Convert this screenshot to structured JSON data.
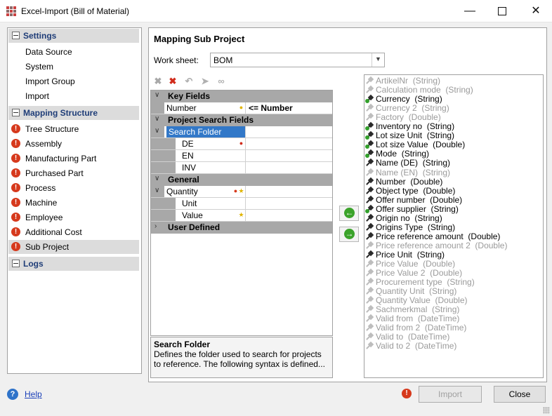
{
  "window": {
    "title": "Excel-Import (Bill of Material)"
  },
  "nav": {
    "settings": {
      "label": "Settings",
      "items": [
        "Data Source",
        "System",
        "Import Group",
        "Import"
      ]
    },
    "mapping": {
      "label": "Mapping Structure",
      "items": [
        "Tree Structure",
        "Assembly",
        "Manufacturing Part",
        "Purchased Part",
        "Process",
        "Machine",
        "Employee",
        "Additional Cost",
        "Sub Project"
      ],
      "selected": "Sub Project"
    },
    "logs": {
      "label": "Logs"
    }
  },
  "main": {
    "title": "Mapping Sub Project",
    "worksheet_label": "Work sheet:",
    "worksheet_value": "BOM"
  },
  "grid": {
    "key_fields": {
      "label": "Key Fields",
      "number_label": "Number",
      "number_value": "<= Number"
    },
    "project_search": {
      "label": "Project Search Fields",
      "search_folder": "Search Folder",
      "de": "DE",
      "en": "EN",
      "inv": "INV"
    },
    "general": {
      "label": "General",
      "quantity": "Quantity",
      "unit": "Unit",
      "value": "Value"
    },
    "user_defined": {
      "label": "User Defined"
    }
  },
  "description": {
    "heading": "Search Folder",
    "text": "Defines the folder used to search for projects to reference. The following syntax is defined..."
  },
  "fields": [
    {
      "name": "ArtikelNr",
      "type": "(String)",
      "active": false,
      "green": false
    },
    {
      "name": "Calculation mode",
      "type": "(String)",
      "active": false,
      "green": false
    },
    {
      "name": "Currency",
      "type": "(String)",
      "active": true,
      "green": true
    },
    {
      "name": "Currency 2",
      "type": "(String)",
      "active": false,
      "green": false
    },
    {
      "name": "Factory",
      "type": "(Double)",
      "active": false,
      "green": false
    },
    {
      "name": "Inventory no",
      "type": "(String)",
      "active": true,
      "green": true
    },
    {
      "name": "Lot size Unit",
      "type": "(String)",
      "active": true,
      "green": true
    },
    {
      "name": "Lot size Value",
      "type": "(Double)",
      "active": true,
      "green": true
    },
    {
      "name": "Mode",
      "type": "(String)",
      "active": true,
      "green": true
    },
    {
      "name": "Name (DE)",
      "type": "(String)",
      "active": true,
      "green": false
    },
    {
      "name": "Name (EN)",
      "type": "(String)",
      "active": false,
      "green": false
    },
    {
      "name": "Number",
      "type": "(Double)",
      "active": true,
      "green": false
    },
    {
      "name": "Object type",
      "type": "(Double)",
      "active": true,
      "green": false
    },
    {
      "name": "Offer number",
      "type": "(Double)",
      "active": true,
      "green": false
    },
    {
      "name": "Offer supplier",
      "type": "(String)",
      "active": true,
      "green": true
    },
    {
      "name": "Origin no",
      "type": "(String)",
      "active": true,
      "green": false
    },
    {
      "name": "Origins Type",
      "type": "(String)",
      "active": true,
      "green": false
    },
    {
      "name": "Price reference amount",
      "type": "(Double)",
      "active": true,
      "green": false
    },
    {
      "name": "Price reference amount 2",
      "type": "(Double)",
      "active": false,
      "green": false
    },
    {
      "name": "Price Unit",
      "type": "(String)",
      "active": true,
      "green": false
    },
    {
      "name": "Price Value",
      "type": "(Double)",
      "active": false,
      "green": false
    },
    {
      "name": "Price Value 2",
      "type": "(Double)",
      "active": false,
      "green": false
    },
    {
      "name": "Procurement type",
      "type": "(String)",
      "active": false,
      "green": false
    },
    {
      "name": "Quantity Unit",
      "type": "(String)",
      "active": false,
      "green": false
    },
    {
      "name": "Quantity Value",
      "type": "(Double)",
      "active": false,
      "green": false
    },
    {
      "name": "Sachmerkmal",
      "type": "(String)",
      "active": false,
      "green": false
    },
    {
      "name": "Valid from",
      "type": "(DateTime)",
      "active": false,
      "green": false
    },
    {
      "name": "Valid from 2",
      "type": "(DateTime)",
      "active": false,
      "green": false
    },
    {
      "name": "Valid to",
      "type": "(DateTime)",
      "active": false,
      "green": false
    },
    {
      "name": "Valid to 2",
      "type": "(DateTime)",
      "active": false,
      "green": false
    }
  ],
  "footer": {
    "help": "Help",
    "import": "Import",
    "close": "Close"
  },
  "colors": {
    "error": "#d6391c",
    "selection": "#3278c8",
    "nav_header_text": "#1f3d78",
    "green": "#33a02c"
  }
}
